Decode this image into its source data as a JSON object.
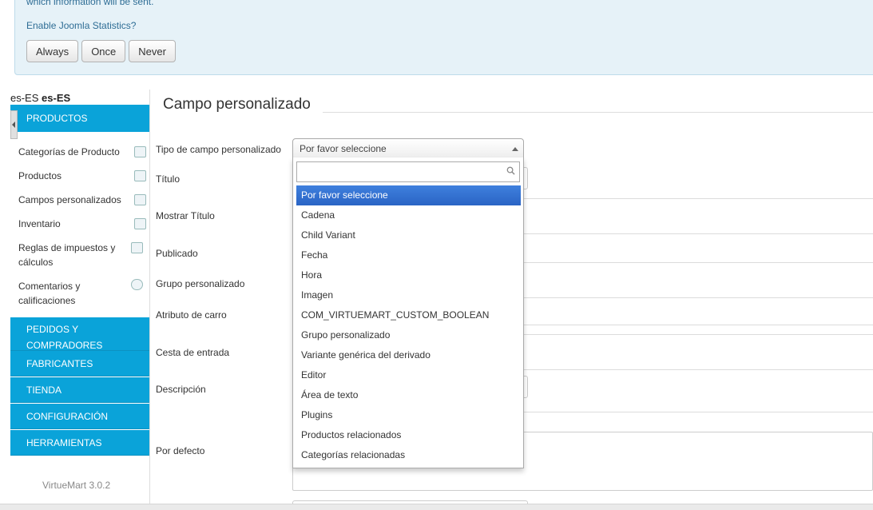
{
  "stats_banner": {
    "message": "which information will be sent.",
    "question": "Enable Joomla Statistics?",
    "buttons": [
      "Always",
      "Once",
      "Never"
    ]
  },
  "sidebar": {
    "lang_label": "es-ES",
    "lang_value": "es-ES",
    "section_title": "PRODUCTOS",
    "items": [
      {
        "label": "Categorías de Producto",
        "icon": "category-icon"
      },
      {
        "label": "Productos",
        "icon": "product-icon"
      },
      {
        "label": "Campos personalizados",
        "icon": "custom-fields-icon"
      },
      {
        "label": "Inventario",
        "icon": "inventory-icon"
      },
      {
        "label": "Reglas de impuestos y cálculos",
        "icon": "tax-rules-icon"
      },
      {
        "label": "Comentarios y calificaciones",
        "icon": "comments-icon"
      }
    ],
    "sections": [
      "PEDIDOS Y COMPRADORES",
      "FABRICANTES",
      "TIENDA",
      "CONFIGURACIÓN",
      "HERRAMIENTAS"
    ],
    "version": "VirtueMart 3.0.2"
  },
  "main": {
    "title": "Campo personalizado",
    "labels": {
      "type": "Tipo de campo personalizado",
      "title": "Título",
      "show_title": "Mostrar Título",
      "published": "Publicado",
      "custom_group": "Grupo personalizado",
      "cart_attribute": "Atributo de carro",
      "cart_input": "Cesta de entrada",
      "description": "Descripción",
      "default": "Por defecto"
    },
    "select": {
      "value": "Por favor seleccione",
      "search_value": "",
      "options": [
        "Por favor seleccione",
        "Cadena",
        "Child Variant",
        "Fecha",
        "Hora",
        "Imagen",
        "COM_VIRTUEMART_CUSTOM_BOOLEAN",
        "Grupo personalizado",
        "Variante genérica del derivado",
        "Editor",
        "Área de texto",
        "Plugins",
        "Productos relacionados",
        "Categorías relacionadas"
      ],
      "highlighted_index": 0
    }
  }
}
